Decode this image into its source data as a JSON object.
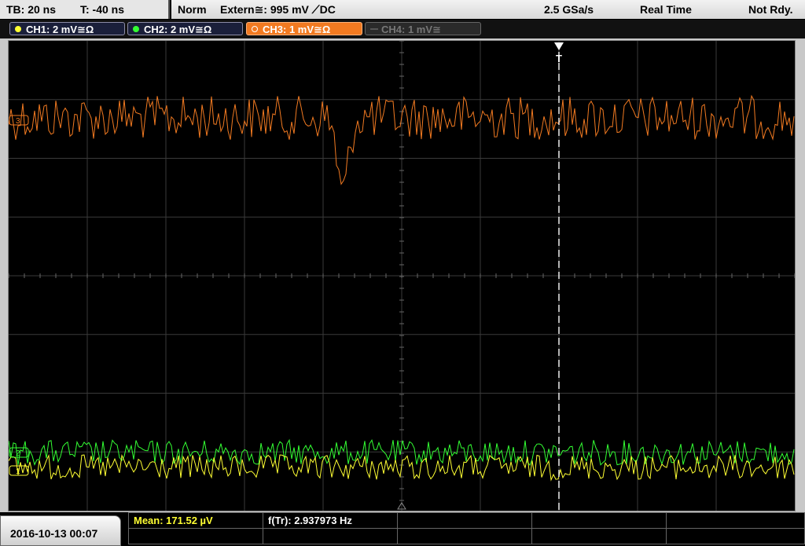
{
  "topbar": {
    "timebase": "TB: 20 ns",
    "trigger_offset": "T: -40 ns",
    "trigger_mode": "Norm",
    "trigger_source": "Extern≅: 995 mV ⟋DC",
    "sample_rate": "2.5 GSa/s",
    "acquisition_mode": "Real Time",
    "status": "Not Rdy."
  },
  "channels": [
    {
      "label": "CH1: 2 mV≅Ω",
      "color": "#ffff33"
    },
    {
      "label": "CH2: 2 mV≅Ω",
      "color": "#33ff33"
    },
    {
      "label": "CH3: 1 mV≅Ω",
      "color": "#f27a21"
    },
    {
      "label": "CH4: 1 mV≅",
      "color": "#666666"
    }
  ],
  "screen": {
    "trigger_marker": "T",
    "ch3_marker": "3",
    "ch1_marker": "1",
    "ch2_marker": "2"
  },
  "measurements": {
    "mean": "Mean: 171.52 µV",
    "freq": "f(Tr): 2.937973 Hz"
  },
  "datetime": "2016-10-13 00:07"
}
